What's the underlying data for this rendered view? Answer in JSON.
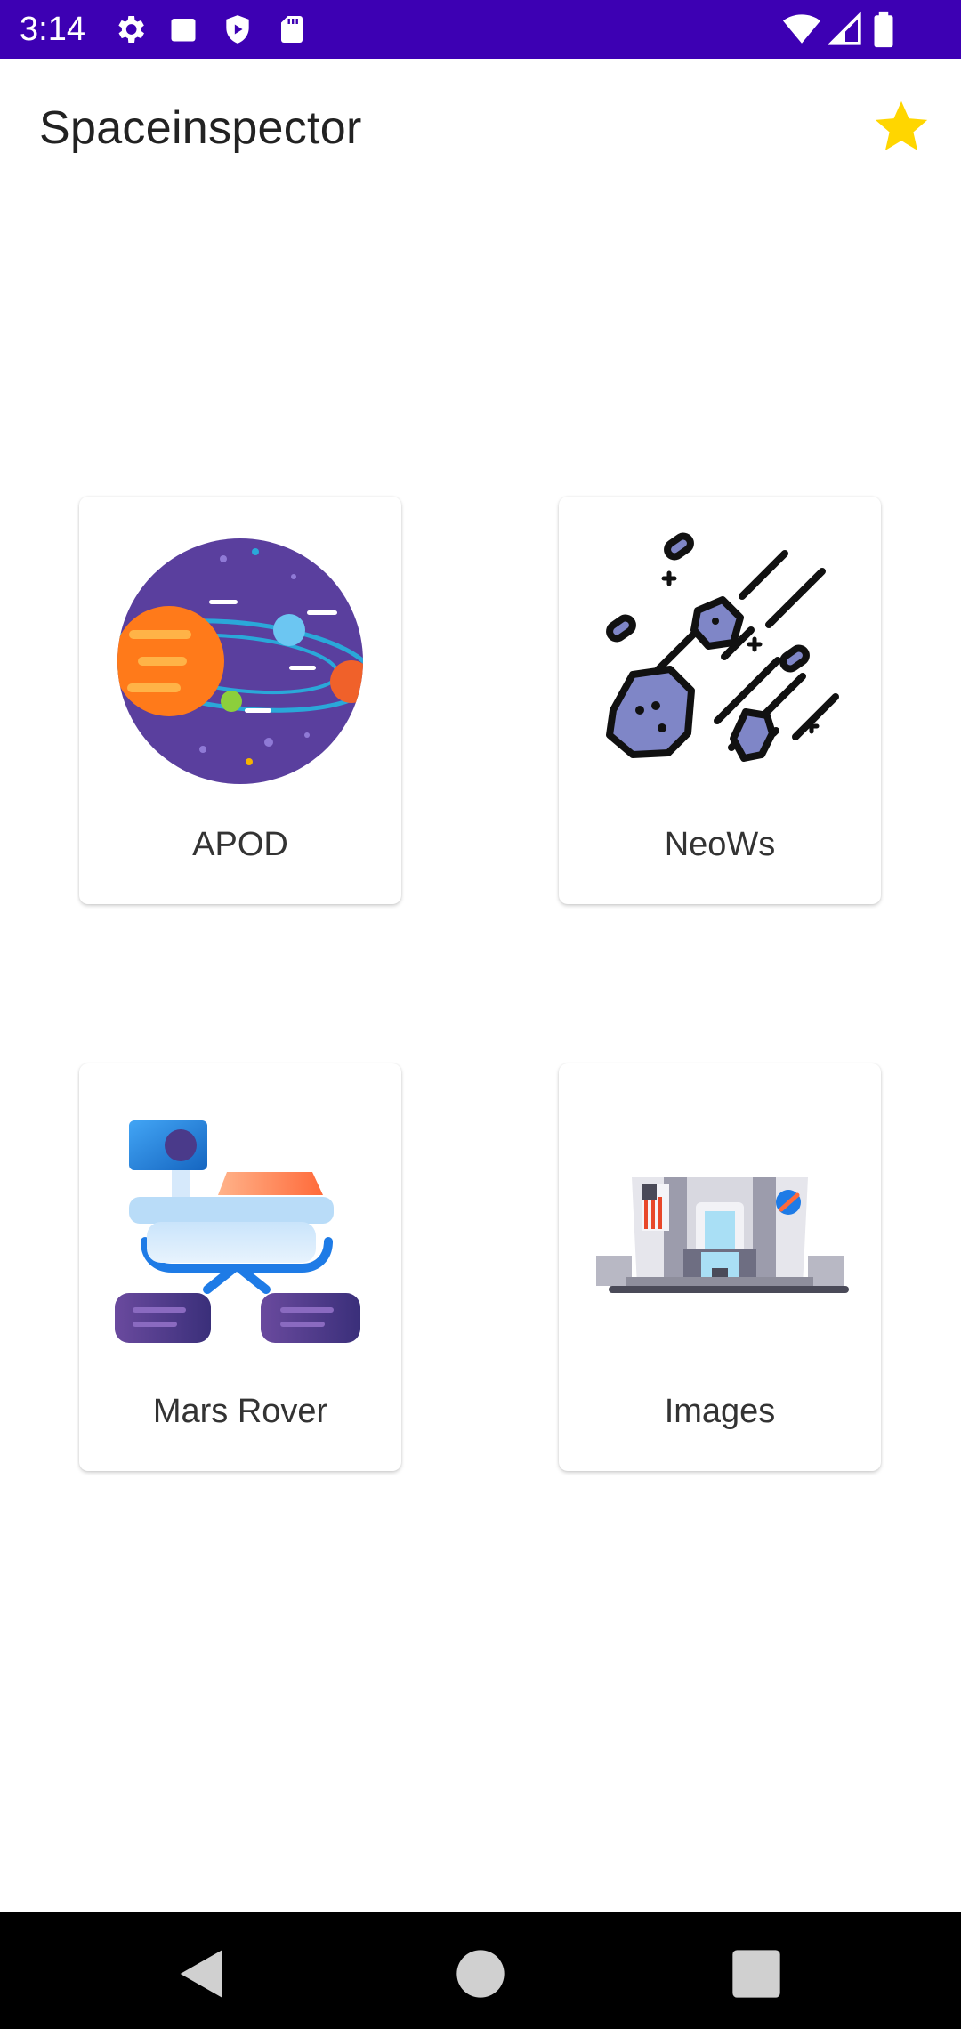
{
  "status_bar": {
    "time": "3:14",
    "left_icons": [
      "gear-icon",
      "square-icon",
      "shield-play-icon",
      "sd-card-icon"
    ],
    "right_icons": [
      "wifi-icon",
      "cell-signal-icon",
      "battery-icon"
    ],
    "background": "#3d00b3"
  },
  "app_bar": {
    "title": "Spaceinspector",
    "action_icon": "star-icon",
    "action_color": "#ffd600"
  },
  "grid": {
    "cards": [
      {
        "label": "APOD",
        "icon": "solar-system-icon"
      },
      {
        "label": "NeoWs",
        "icon": "meteor-shower-icon"
      },
      {
        "label": "Mars Rover",
        "icon": "mars-rover-icon"
      },
      {
        "label": "Images",
        "icon": "space-center-building-icon"
      }
    ]
  },
  "nav_bar": {
    "buttons": [
      "back-icon",
      "home-icon",
      "recents-icon"
    ]
  }
}
